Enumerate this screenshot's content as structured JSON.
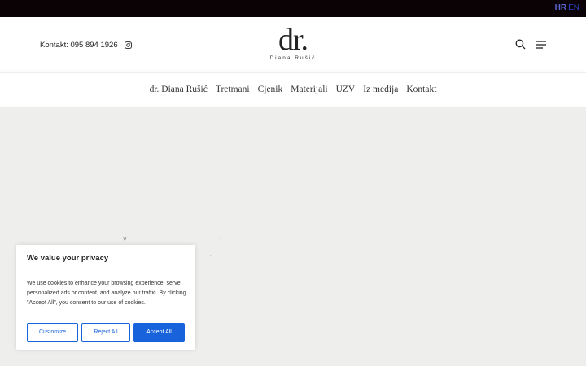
{
  "topbar": {
    "lang_hr": "HR",
    "lang_en": "EN"
  },
  "header": {
    "contact_text": "Kontakt: 095 894 1926",
    "logo_mark": "dr.",
    "logo_subtitle": "Diana Rušić",
    "icons": [
      "instagram-icon",
      "search-icon",
      "menu-icon"
    ]
  },
  "nav": {
    "items": [
      "dr. Diana Rušić",
      "Tretmani",
      "Cjenik",
      "Materijali",
      "UZV",
      "Iz medija",
      "Kontakt"
    ]
  },
  "cookie": {
    "title": "We value your privacy",
    "body": "We use cookies to enhance your browsing experience, serve personalized ads or content, and analyze our traffic. By clicking \"Accept All\", you consent to our use of cookies.",
    "customize_label": "Customize",
    "reject_label": "Reject All",
    "accept_label": "Accept All"
  },
  "colors": {
    "accent": "#1863dc",
    "topbar": "#0b0205",
    "hero_bg": "#eeeeec"
  }
}
